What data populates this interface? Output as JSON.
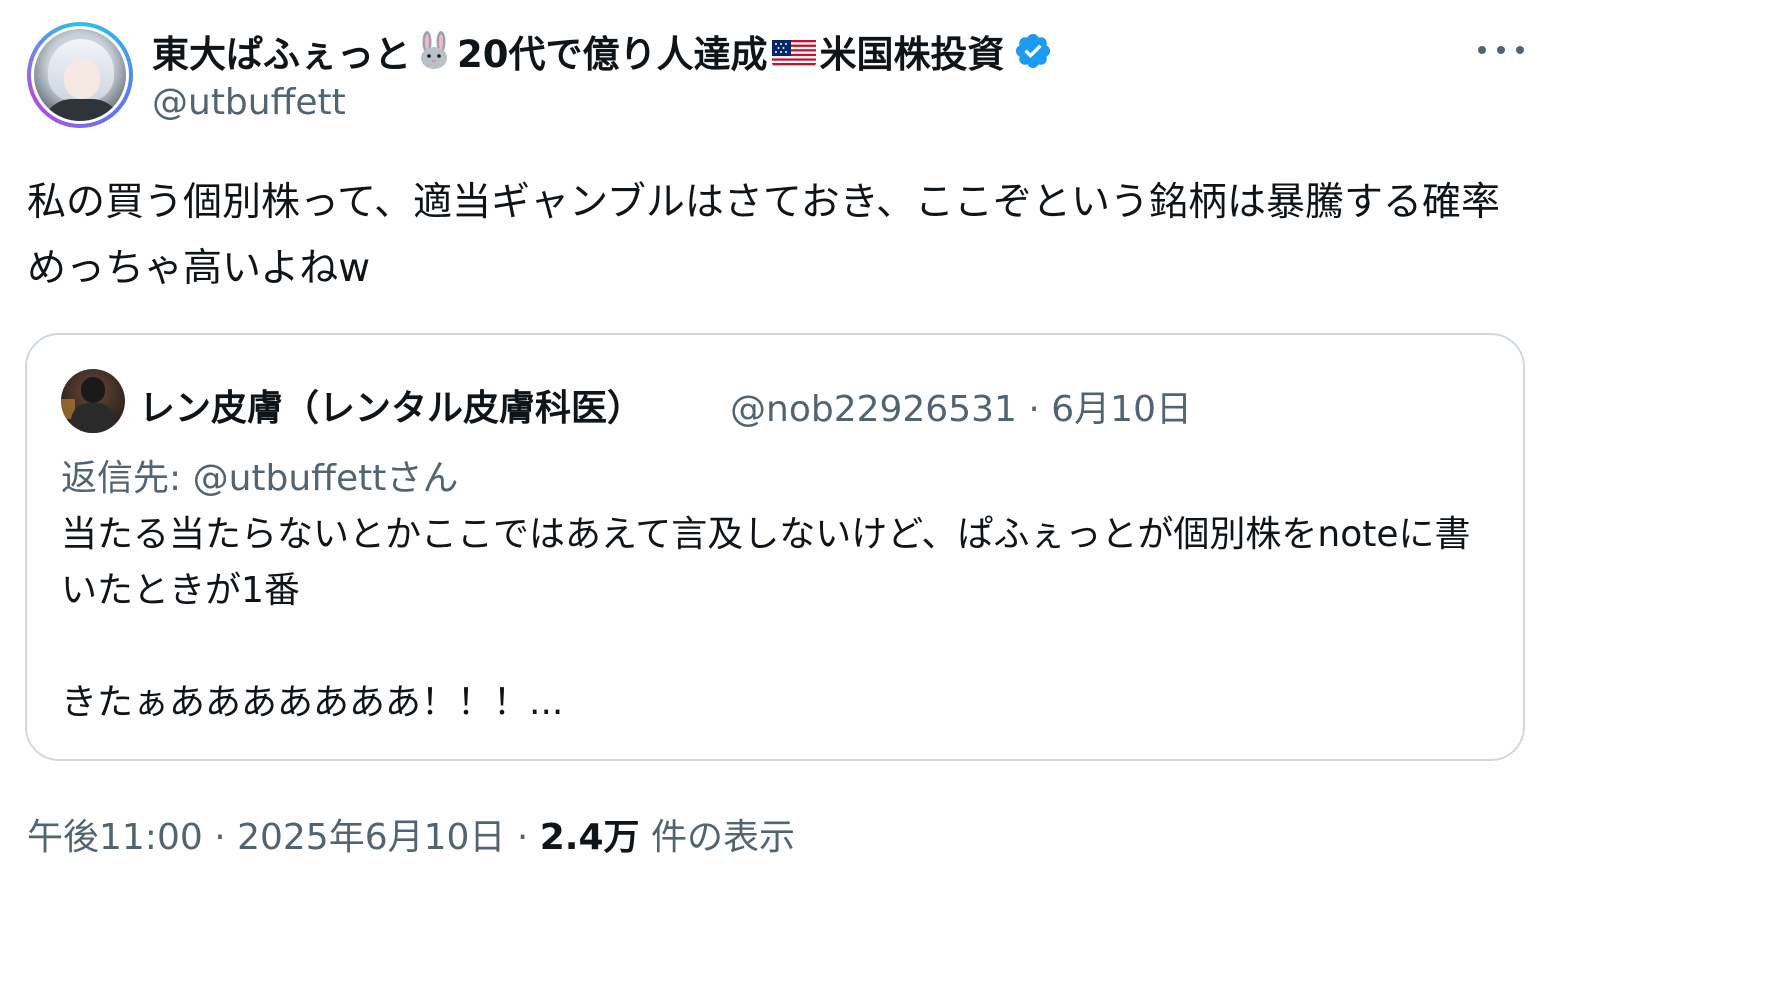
{
  "author": {
    "name_part1": "東大ぱふぇっと",
    "emoji1": "rabbit-emoji",
    "name_part2": "20代で億り人達成",
    "emoji2": "us-flag-emoji",
    "name_part3": "米国株投資",
    "handle": "@utbuffett",
    "verified_color": "#1d9bf0"
  },
  "tweet": {
    "text": "私の買う個別株って、適当ギャンブルはさておき、ここぞという銘柄は暴騰する確率めっちゃ高いよねw"
  },
  "quote": {
    "name": "レン皮膚（レンタル皮膚科医）",
    "handle_date": "@nob22926531 · 6月10日",
    "reply_to": "返信先: @utbuffettさん",
    "text_line1": "当たる当たらないとかここではあえて言及しないけど、ぱふぇっとが個別株をnoteに書いたときが1番",
    "text_line2": "きたぁあああああああ！！！..."
  },
  "footer": {
    "timestamp": "午後11:00 · 2025年6月10日 · ",
    "views_count": "2.4万",
    "views_label": " 件の表示"
  },
  "colors": {
    "text": "#0f1419",
    "secondary": "#536471",
    "border": "#cfd9de"
  }
}
